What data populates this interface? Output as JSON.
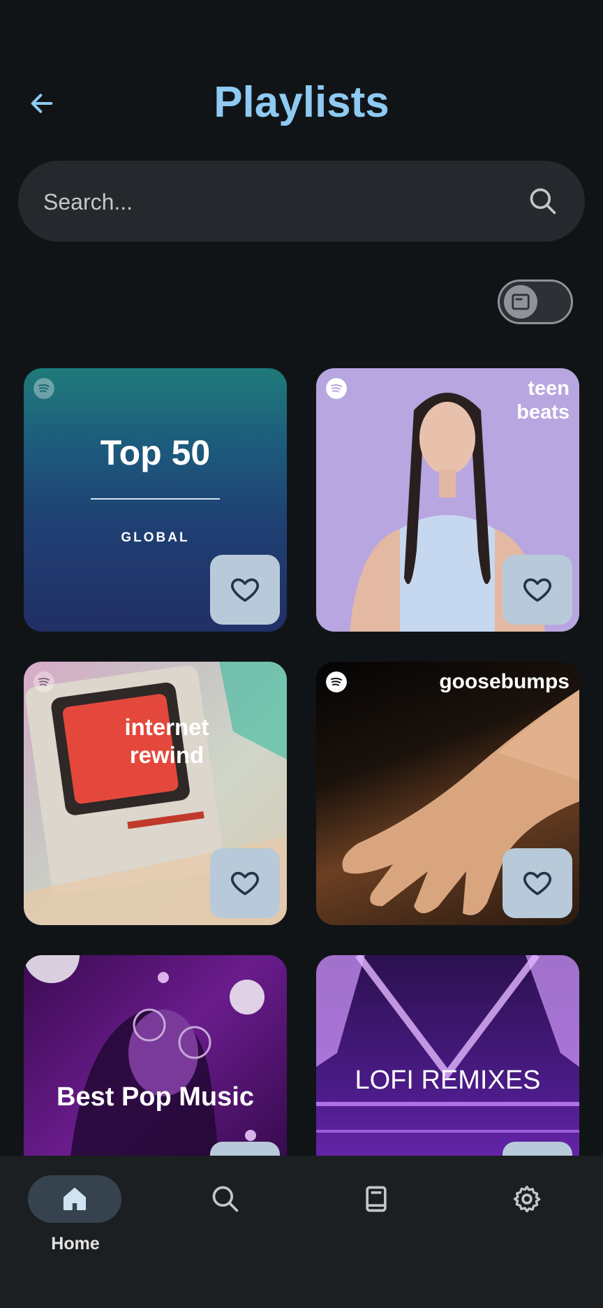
{
  "header": {
    "title": "Playlists",
    "back_icon": "arrow-left-icon"
  },
  "search": {
    "placeholder": "Search...",
    "icon": "search-icon"
  },
  "view_toggle": {
    "icon": "view-layout-icon",
    "state": "off"
  },
  "playlists": [
    {
      "title": "Top 50",
      "subtitle": "GLOBAL",
      "favorite": false
    },
    {
      "title": "teen beats",
      "favorite": false
    },
    {
      "title": "internet rewind",
      "favorite": false
    },
    {
      "title": "goosebumps",
      "favorite": false
    },
    {
      "title": "Best Pop Music",
      "favorite": false
    },
    {
      "title": "LOFI REMIXES",
      "favorite": false
    }
  ],
  "bottom_nav": {
    "items": [
      {
        "label": "Home",
        "icon": "home-icon",
        "active": true
      },
      {
        "label": "",
        "icon": "search-icon",
        "active": false
      },
      {
        "label": "",
        "icon": "library-icon",
        "active": false
      },
      {
        "label": "",
        "icon": "gear-icon",
        "active": false
      }
    ]
  },
  "colors": {
    "background": "#111417",
    "accent": "#8ecaf2",
    "favorite_button": "#b8cad9",
    "nav_active": "#36434f"
  }
}
